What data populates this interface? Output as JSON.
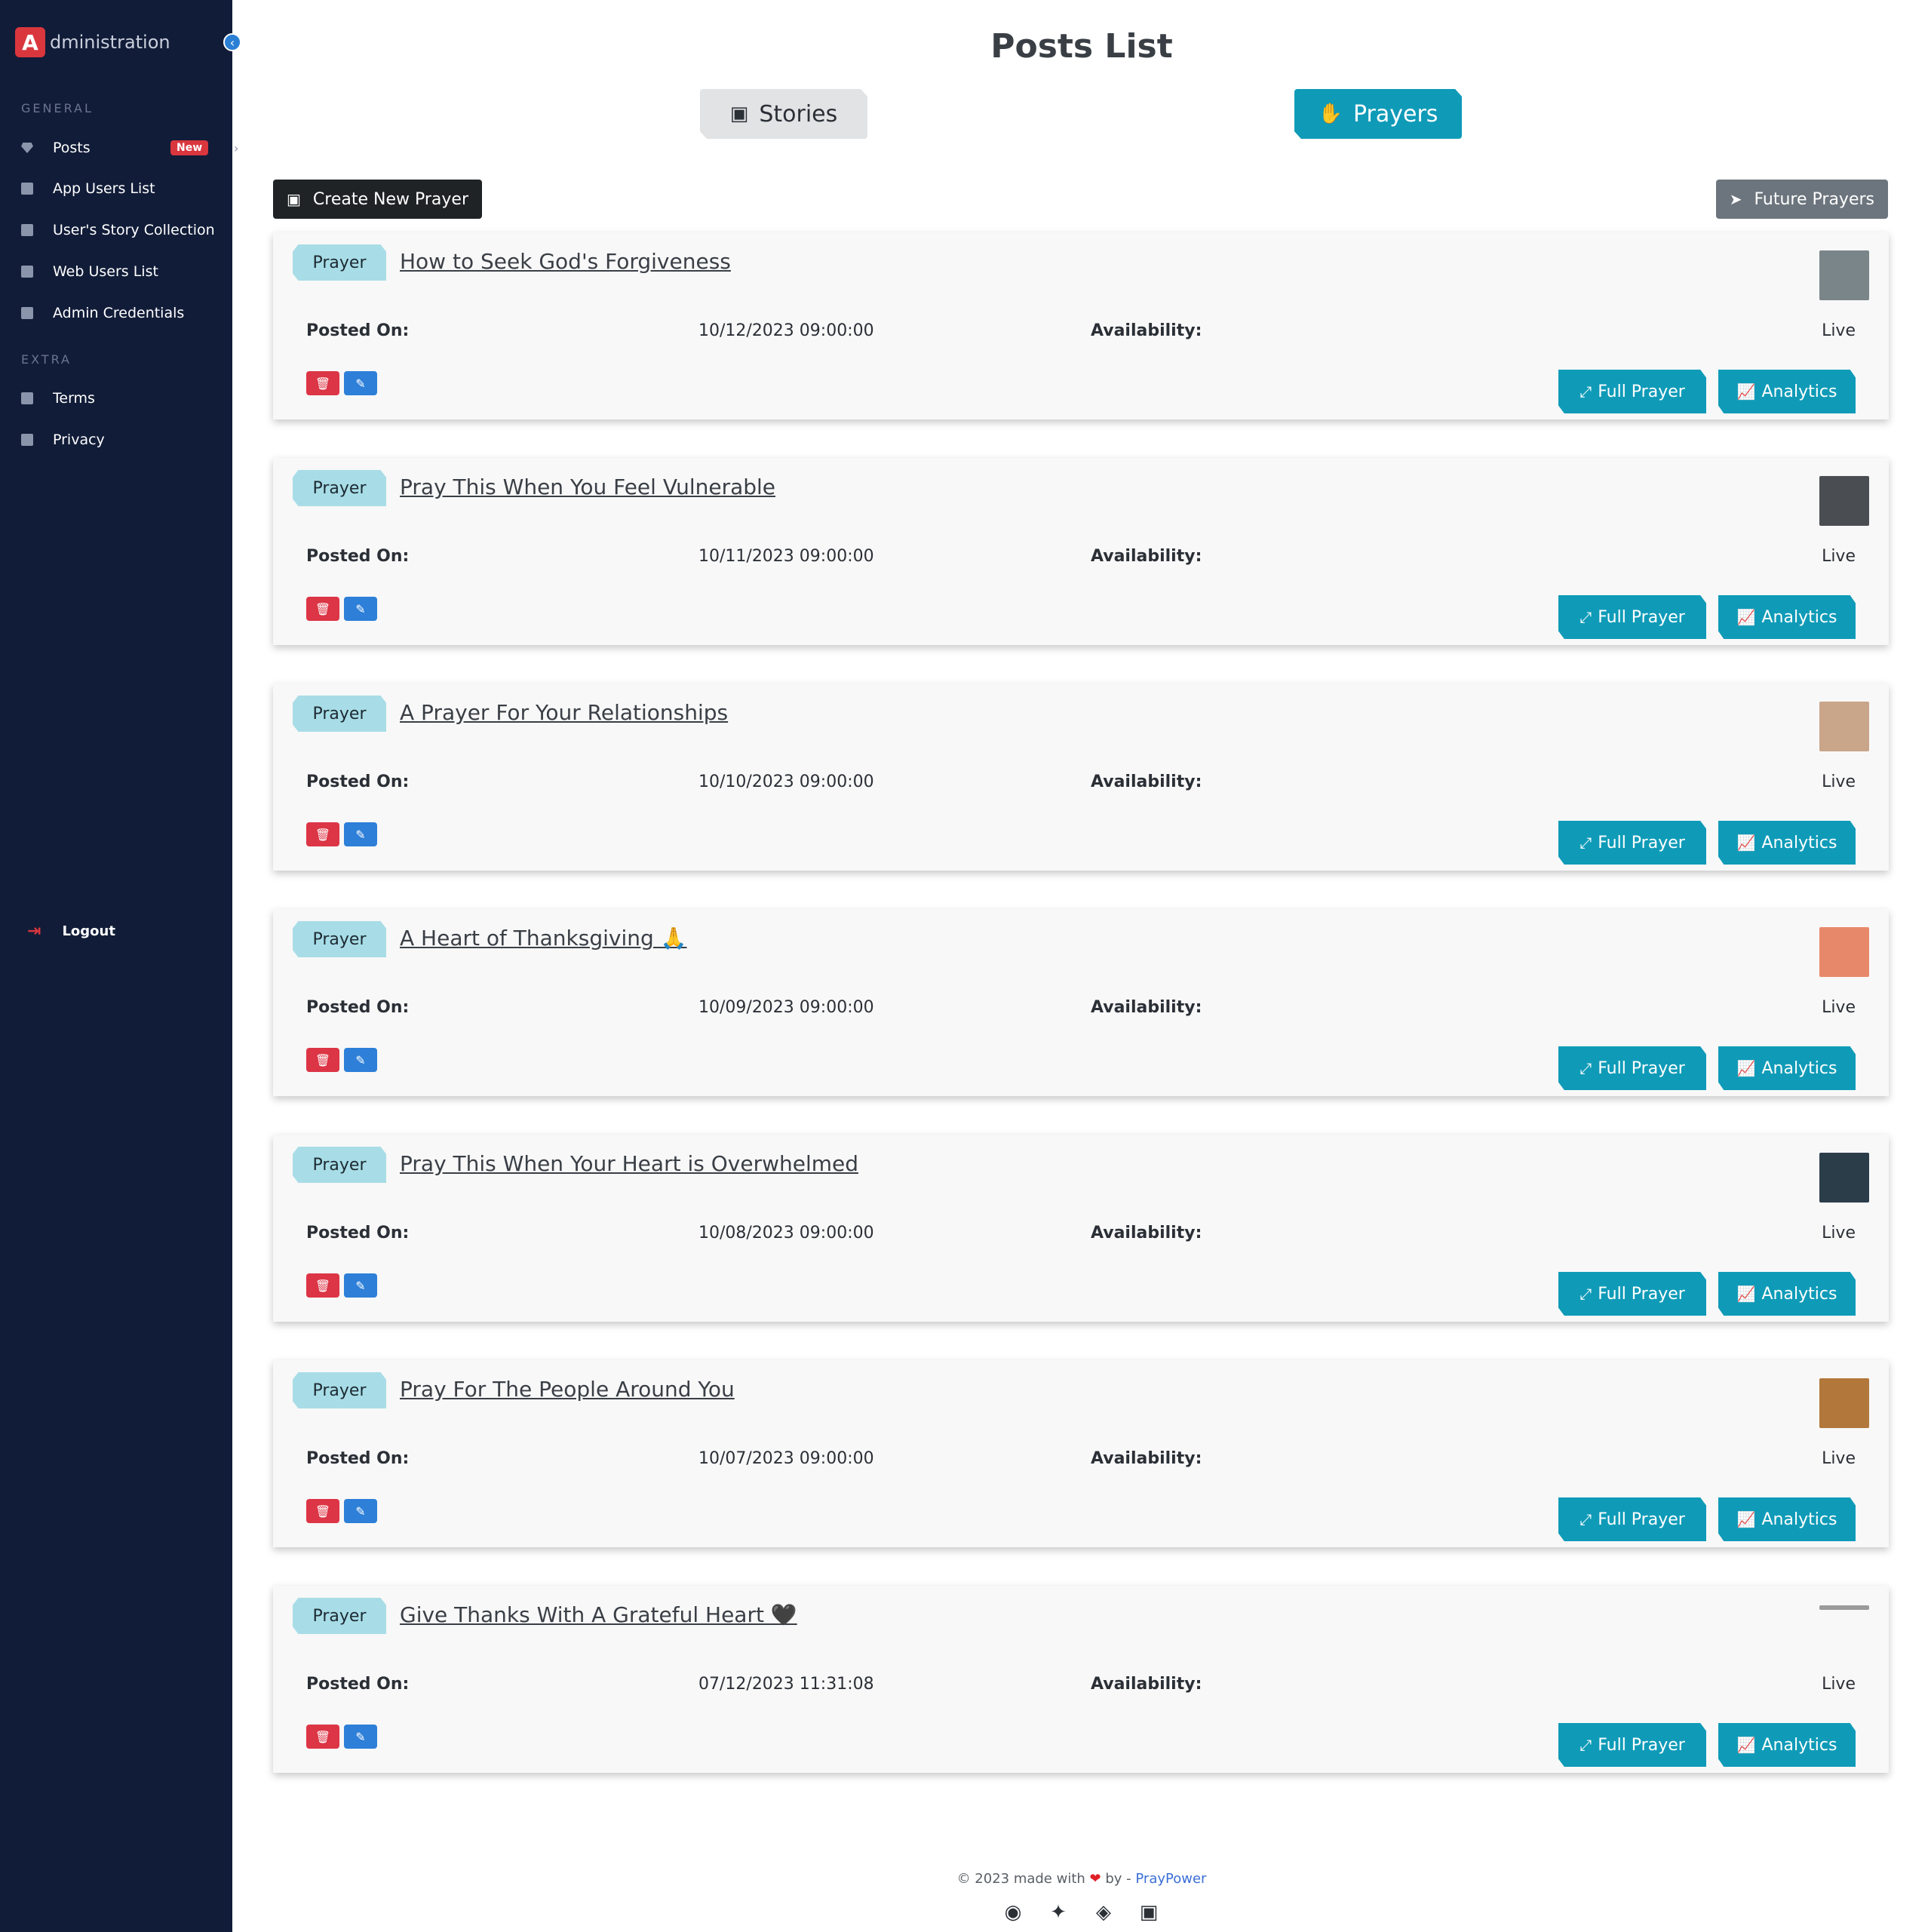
{
  "brand": {
    "logo_letter": "A",
    "text": "dministration",
    "collapse_icon": "chevron-left-icon"
  },
  "sidebar": {
    "sections": {
      "general": "GENERAL",
      "extra": "EXTRA"
    },
    "items": [
      {
        "label": "Posts",
        "icon": "diamond-icon",
        "badge": "New",
        "chevron": "›"
      },
      {
        "label": "App Users List",
        "icon": "page-icon"
      },
      {
        "label": "User's Story Collection",
        "icon": "page-icon"
      },
      {
        "label": "Web Users List",
        "icon": "page-icon"
      },
      {
        "label": "Admin Credentials",
        "icon": "page-icon"
      },
      {
        "label": "Terms",
        "icon": "page-icon"
      },
      {
        "label": "Privacy",
        "icon": "page-icon"
      }
    ],
    "logout": {
      "label": "Logout",
      "icon": "logout-icon"
    }
  },
  "header": {
    "title": "Posts List",
    "tabs": [
      {
        "label": "Stories",
        "icon": "book-icon",
        "active": false
      },
      {
        "label": "Prayers",
        "icon": "praying-hands-icon",
        "active": true
      }
    ]
  },
  "toolbar": {
    "create_label": "Create New Prayer",
    "create_icon": "box-icon",
    "future_label": "Future Prayers",
    "future_icon": "send-icon"
  },
  "labels": {
    "posted_on": "Posted On:",
    "availability": "Availability:",
    "full_prayer": "Full Prayer",
    "analytics": "Analytics"
  },
  "posts": [
    {
      "type": "Prayer",
      "title": "How to Seek God's Forgiveness",
      "posted": "10/12/2023 09:00:00",
      "availability": "Live",
      "thumb_color": "#7a8589"
    },
    {
      "type": "Prayer",
      "title": "Pray This When You Feel Vulnerable",
      "posted": "10/11/2023 09:00:00",
      "availability": "Live",
      "thumb_color": "#4a4d52"
    },
    {
      "type": "Prayer",
      "title": "A Prayer For Your Relationships",
      "posted": "10/10/2023 09:00:00",
      "availability": "Live",
      "thumb_color": "#c9a58a"
    },
    {
      "type": "Prayer",
      "title": "A Heart of Thanksgiving 🙏",
      "posted": "10/09/2023 09:00:00",
      "availability": "Live",
      "thumb_color": "#e8886a"
    },
    {
      "type": "Prayer",
      "title": "Pray This When Your Heart is Overwhelmed",
      "posted": "10/08/2023 09:00:00",
      "availability": "Live",
      "thumb_color": "#2c3d4a"
    },
    {
      "type": "Prayer",
      "title": "Pray For The People Around You",
      "posted": "10/07/2023 09:00:00",
      "availability": "Live",
      "thumb_color": "#b2773a"
    },
    {
      "type": "Prayer",
      "title": "Give Thanks With A Grateful Heart 🖤",
      "posted": "07/12/2023 11:31:08",
      "availability": "Live",
      "thumb_color": "#9a9a9a"
    }
  ],
  "footer": {
    "prefix": "© 2023 made with",
    "heart": "❤",
    "by": "by -",
    "brand": "PrayPower",
    "socials": [
      "github-icon",
      "twitter-icon",
      "codepen-icon",
      "linkedin-icon"
    ]
  },
  "colors": {
    "sidebar": "#111c38",
    "accent": "#0f9bb8",
    "danger": "#dc3545",
    "primary": "#2d7fd8",
    "tag": "#a8dde7"
  }
}
